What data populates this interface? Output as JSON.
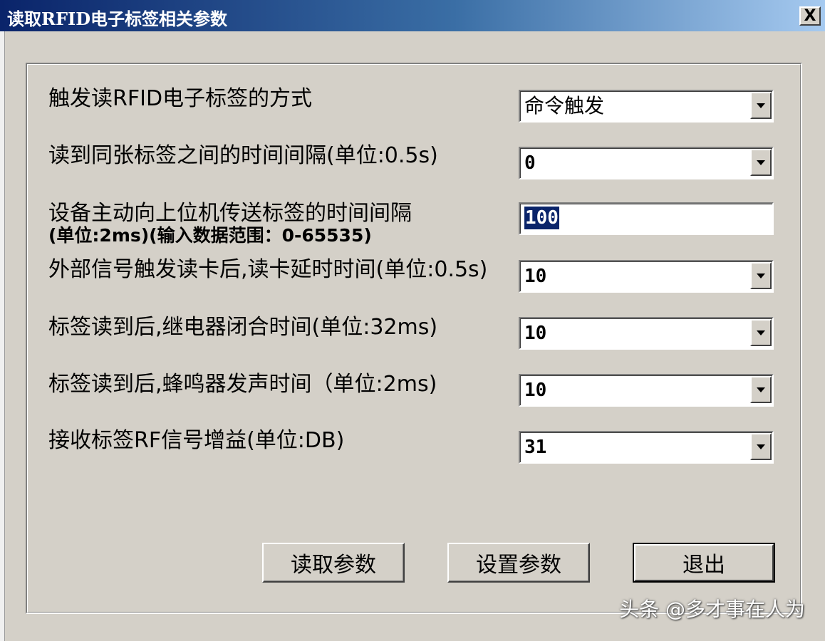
{
  "window": {
    "title": "读取RFID电子标签相关参数",
    "close_label": "X"
  },
  "params": [
    {
      "label": "触发读RFID电子标签的方式",
      "value": "命令触发",
      "control": "combo"
    },
    {
      "label": "读到同张标签之间的时间间隔(单位:0.5s)",
      "value": "0",
      "control": "combo"
    },
    {
      "label": "设备主动向上位机传送标签的时间间隔",
      "sublabel": "(单位:2ms)(输入数据范围：0-65535)",
      "value": "100",
      "control": "textbox"
    },
    {
      "label": "外部信号触发读卡后,读卡延时时间(单位:0.5s)",
      "value": "10",
      "control": "combo"
    },
    {
      "label": "标签读到后,继电器闭合时间(单位:32ms)",
      "value": "10",
      "control": "combo"
    },
    {
      "label": "标签读到后,蜂鸣器发声时间（单位:2ms)",
      "value": "10",
      "control": "combo"
    },
    {
      "label": "接收标签RF信号增益(单位:DB)",
      "value": "31",
      "control": "combo"
    }
  ],
  "buttons": {
    "read_label": "读取参数",
    "set_label": "设置参数",
    "exit_label": "退出"
  },
  "watermark": "头条 @多才事在人为",
  "colors": {
    "face": "#d4d0c8",
    "titlebar_start": "#0a246a",
    "titlebar_end": "#a6caf0",
    "selection": "#0a246a"
  }
}
